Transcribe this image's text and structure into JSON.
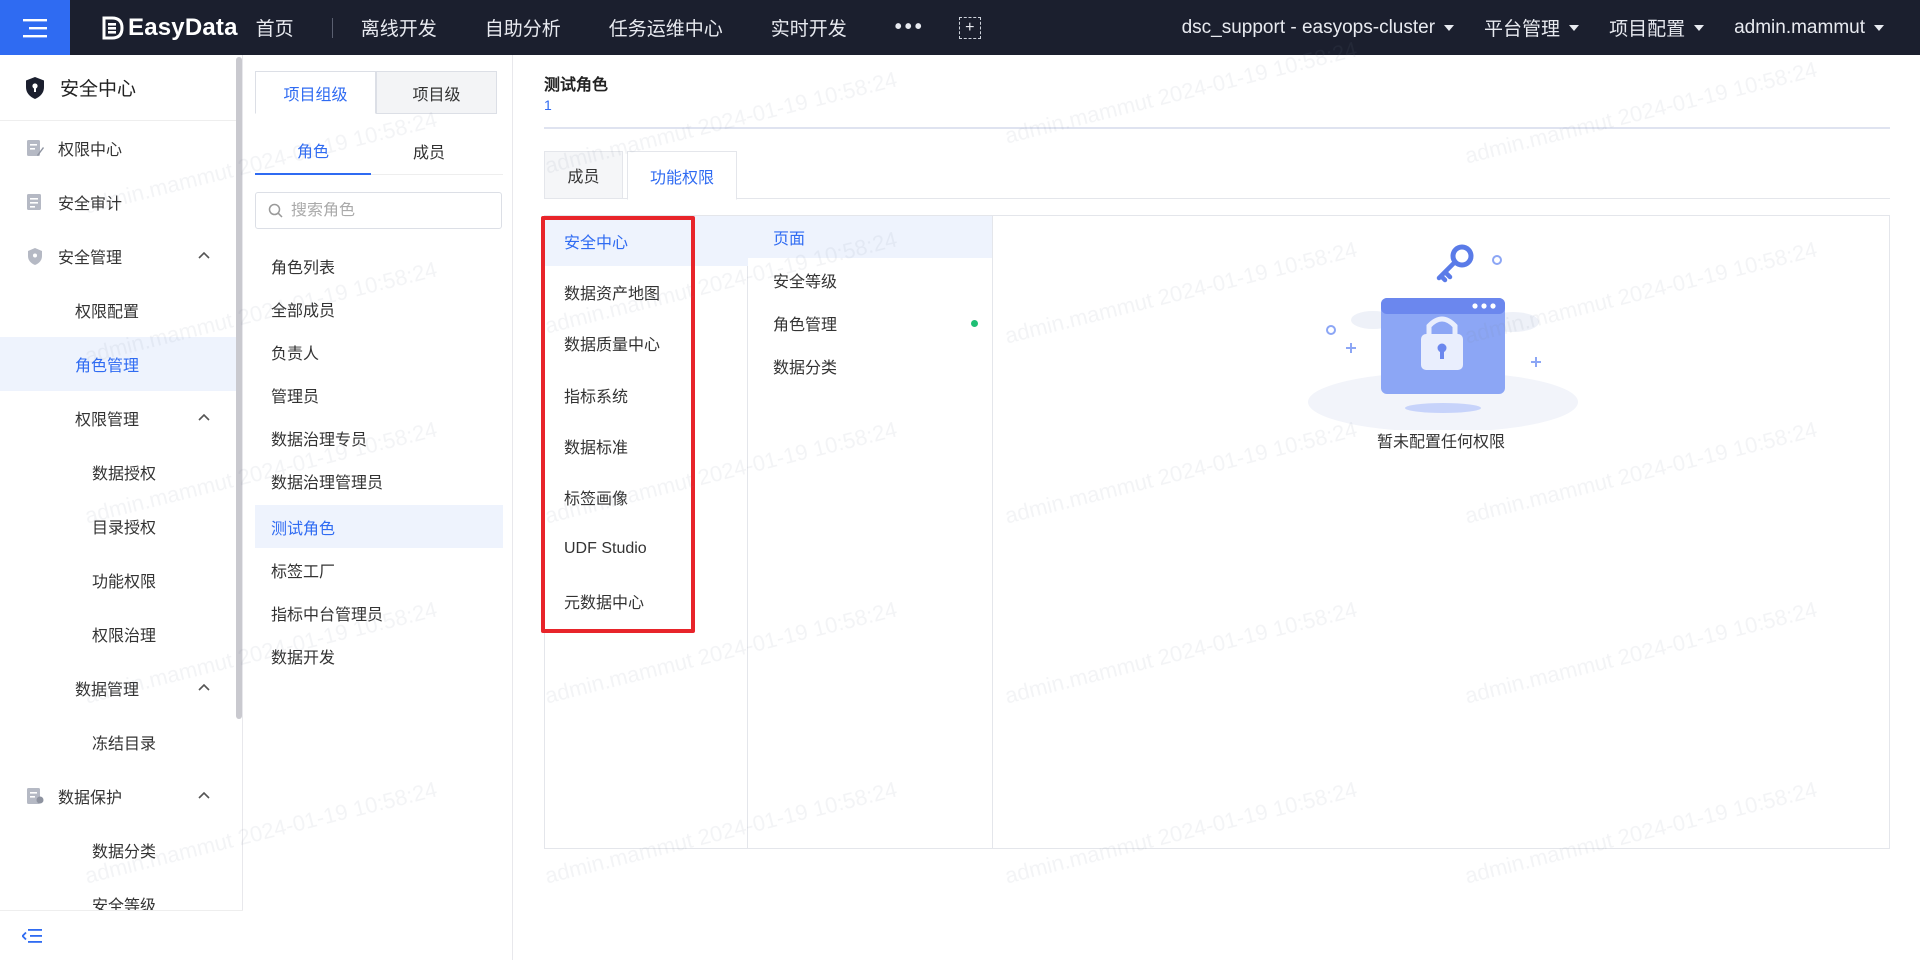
{
  "topbar": {
    "brand": "EasyData",
    "nav": [
      "首页",
      "离线开发",
      "自助分析",
      "任务运维中心",
      "实时开发"
    ],
    "more": "•••",
    "cluster": "dsc_support - easyops-cluster",
    "platform_admin": "平台管理",
    "project_config": "项目配置",
    "user": "admin.mammut"
  },
  "sidebar": {
    "title": "安全中心",
    "items": [
      {
        "label": "权限中心"
      },
      {
        "label": "安全审计"
      },
      {
        "label": "安全管理"
      },
      {
        "label": "权限配置"
      },
      {
        "label": "角色管理"
      },
      {
        "label": "权限管理"
      },
      {
        "label": "数据授权"
      },
      {
        "label": "目录授权"
      },
      {
        "label": "功能权限"
      },
      {
        "label": "权限治理"
      },
      {
        "label": "数据管理"
      },
      {
        "label": "冻结目录"
      },
      {
        "label": "数据保护"
      },
      {
        "label": "数据分类"
      },
      {
        "label": "安全等级"
      }
    ]
  },
  "role_panel": {
    "seg": [
      "项目组级",
      "项目级"
    ],
    "tabs": [
      "角色",
      "成员"
    ],
    "search_placeholder": "搜索角色",
    "roles": [
      "角色列表",
      "全部成员",
      "负责人",
      "管理员",
      "数据治理专员",
      "数据治理管理员",
      "测试角色",
      "标签工厂",
      "指标中台管理员",
      "数据开发"
    ]
  },
  "main": {
    "role_title": "测试角色",
    "role_count": "1",
    "tabs": [
      "成员",
      "功能权限"
    ],
    "modules": [
      "安全中心",
      "数据资产地图",
      "数据质量中心",
      "指标系统",
      "数据标准",
      "标签画像",
      "UDF Studio",
      "元数据中心"
    ],
    "perms": [
      "页面",
      "安全等级",
      "角色管理",
      "数据分类"
    ],
    "empty_text": "暂未配置任何权限"
  },
  "watermark": "admin.mammut 2024-01-19 10:58:24",
  "colors": {
    "accent": "#2f6bf2",
    "topbar": "#1b1f2e",
    "highlight": "#e8242a",
    "dot": "#1fbf75"
  }
}
